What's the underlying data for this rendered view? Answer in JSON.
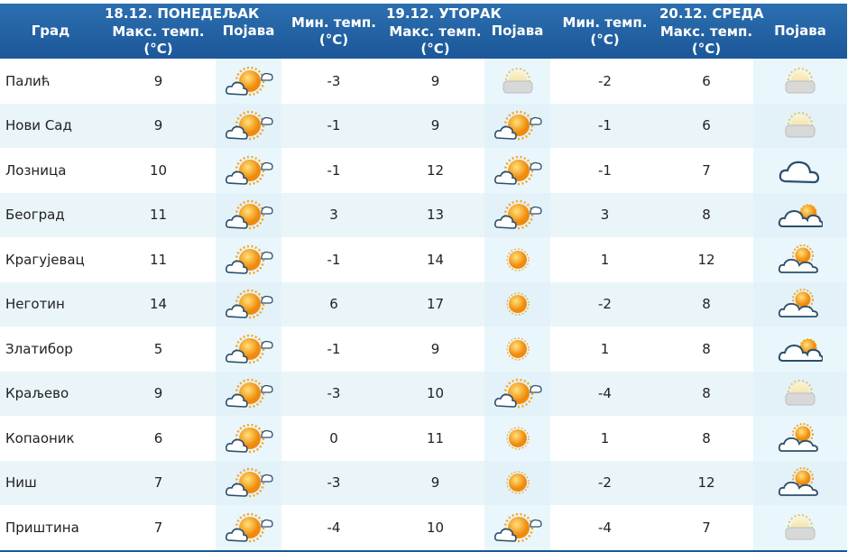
{
  "days": [
    {
      "date": "18.12. ПОНЕДЕЉАК"
    },
    {
      "date": "19.12. УТОРАК"
    },
    {
      "date": "20.12. СРЕДА"
    }
  ],
  "headers": {
    "city": "Град",
    "max_temp": "Макс. темп.",
    "min_temp": "Мин. темп.",
    "unit": "(°C)",
    "weather": "Појава"
  },
  "rows": [
    {
      "city": "Палић",
      "d1_max": "9",
      "d1_icon": "sun-behind-cloud-icon",
      "d2_min": "-3",
      "d2_max": "9",
      "d2_icon": "overcast-sun-icon",
      "d3_min": "-2",
      "d3_max": "6",
      "d3_icon": "overcast-sun-icon"
    },
    {
      "city": "Нови Сад",
      "d1_max": "9",
      "d1_icon": "sun-behind-cloud-icon",
      "d2_min": "-1",
      "d2_max": "9",
      "d2_icon": "sun-behind-cloud-icon",
      "d3_min": "-1",
      "d3_max": "6",
      "d3_icon": "overcast-sun-icon"
    },
    {
      "city": "Лозница",
      "d1_max": "10",
      "d1_icon": "sun-behind-cloud-icon",
      "d2_min": "-1",
      "d2_max": "12",
      "d2_icon": "sun-behind-cloud-icon",
      "d3_min": "-1",
      "d3_max": "7",
      "d3_icon": "cloud-icon"
    },
    {
      "city": "Београд",
      "d1_max": "11",
      "d1_icon": "sun-behind-cloud-icon",
      "d2_min": "3",
      "d2_max": "13",
      "d2_icon": "sun-behind-cloud-icon",
      "d3_min": "3",
      "d3_max": "8",
      "d3_icon": "clouds-with-sun-icon"
    },
    {
      "city": "Крагујевац",
      "d1_max": "11",
      "d1_icon": "sun-behind-cloud-icon",
      "d2_min": "-1",
      "d2_max": "14",
      "d2_icon": "sun-icon",
      "d3_min": "1",
      "d3_max": "12",
      "d3_icon": "partly-cloudy-icon"
    },
    {
      "city": "Неготин",
      "d1_max": "14",
      "d1_icon": "sun-behind-cloud-icon",
      "d2_min": "6",
      "d2_max": "17",
      "d2_icon": "sun-icon",
      "d3_min": "-2",
      "d3_max": "8",
      "d3_icon": "partly-cloudy-icon"
    },
    {
      "city": "Златибор",
      "d1_max": "5",
      "d1_icon": "sun-behind-cloud-icon",
      "d2_min": "-1",
      "d2_max": "9",
      "d2_icon": "sun-icon",
      "d3_min": "1",
      "d3_max": "8",
      "d3_icon": "clouds-with-sun-icon"
    },
    {
      "city": "Краљево",
      "d1_max": "9",
      "d1_icon": "sun-behind-cloud-icon",
      "d2_min": "-3",
      "d2_max": "10",
      "d2_icon": "sun-behind-cloud-icon",
      "d3_min": "-4",
      "d3_max": "8",
      "d3_icon": "overcast-sun-icon"
    },
    {
      "city": "Копаоник",
      "d1_max": "6",
      "d1_icon": "sun-behind-cloud-icon",
      "d2_min": "0",
      "d2_max": "11",
      "d2_icon": "sun-icon",
      "d3_min": "1",
      "d3_max": "8",
      "d3_icon": "partly-cloudy-icon"
    },
    {
      "city": "Ниш",
      "d1_max": "7",
      "d1_icon": "sun-behind-cloud-icon",
      "d2_min": "-3",
      "d2_max": "9",
      "d2_icon": "sun-icon",
      "d3_min": "-2",
      "d3_max": "12",
      "d3_icon": "partly-cloudy-icon"
    },
    {
      "city": "Приштина",
      "d1_max": "7",
      "d1_icon": "sun-behind-cloud-icon",
      "d2_min": "-4",
      "d2_max": "10",
      "d2_icon": "sun-behind-cloud-icon",
      "d3_min": "-4",
      "d3_max": "7",
      "d3_icon": "overcast-sun-icon"
    }
  ],
  "colors": {
    "header_bg": "#1b5799",
    "header_text": "#ffffff",
    "row_alt": "#eaf5fa",
    "sun": "#f5a623",
    "cloud_outline": "#2a4f6e"
  }
}
